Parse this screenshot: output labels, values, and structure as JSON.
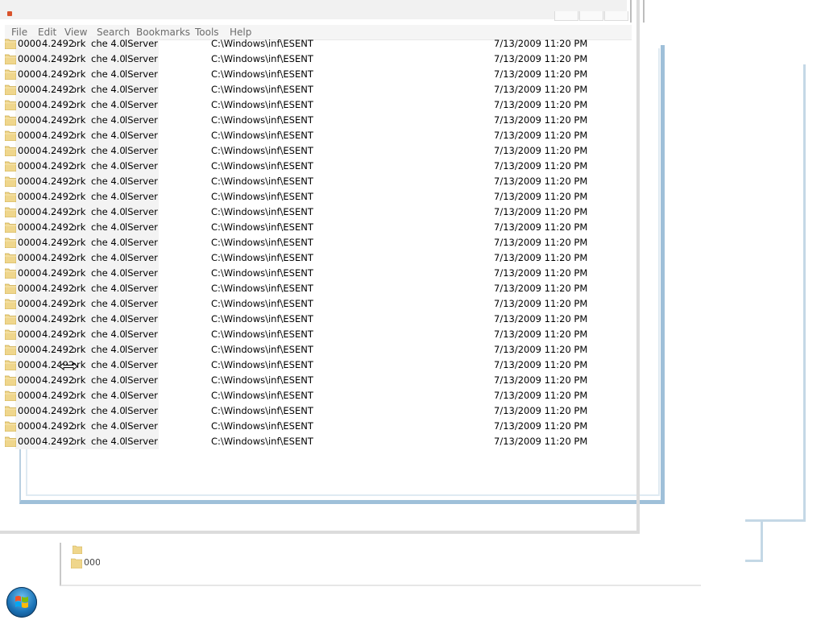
{
  "window": {
    "title": "",
    "menu": [
      "File",
      "Edit",
      "View",
      "Search",
      "Bookmarks",
      "Tools",
      "Help"
    ]
  },
  "list": {
    "rows": [
      [
        "0000",
        "4.2492",
        "ork",
        "che 4.0",
        "lServer",
        "C:\\Windows\\inf\\ESENT",
        "7/13/2009 11:20 PM"
      ],
      [
        "0000",
        "4.2492",
        "ork",
        "che 4.0",
        "lServer",
        "C:\\Windows\\inf\\ESENT",
        "7/13/2009 11:20 PM"
      ],
      [
        "0000",
        "4.2492",
        "ork",
        "che 4.0",
        "lServer",
        "C:\\Windows\\inf\\ESENT",
        "7/13/2009 11:20 PM"
      ],
      [
        "0000",
        "4.2492",
        "ork",
        "che 4.0",
        "lServer",
        "C:\\Windows\\inf\\ESENT",
        "7/13/2009 11:20 PM"
      ],
      [
        "0000",
        "4.2492",
        "ork",
        "che 4.0",
        "lServer",
        "C:\\Windows\\inf\\ESENT",
        "7/13/2009 11:20 PM"
      ],
      [
        "0000",
        "4.2492",
        "ork",
        "che 4.0",
        "lServer",
        "C:\\Windows\\inf\\ESENT",
        "7/13/2009 11:20 PM"
      ],
      [
        "0000",
        "4.2492",
        "ork",
        "che 4.0",
        "lServer",
        "C:\\Windows\\inf\\ESENT",
        "7/13/2009 11:20 PM"
      ],
      [
        "0000",
        "4.2492",
        "ork",
        "che 4.0",
        "lServer",
        "C:\\Windows\\inf\\ESENT",
        "7/13/2009 11:20 PM"
      ],
      [
        "0000",
        "4.2492",
        "ork",
        "che 4.0",
        "lServer",
        "C:\\Windows\\inf\\ESENT",
        "7/13/2009 11:20 PM"
      ],
      [
        "0000",
        "4.2492",
        "ork",
        "che 4.0",
        "lServer",
        "C:\\Windows\\inf\\ESENT",
        "7/13/2009 11:20 PM"
      ],
      [
        "0000",
        "4.2492",
        "ork",
        "che 4.0",
        "lServer",
        "C:\\Windows\\inf\\ESENT",
        "7/13/2009 11:20 PM"
      ],
      [
        "0000",
        "4.2492",
        "ork",
        "che 4.0",
        "lServer",
        "C:\\Windows\\inf\\ESENT",
        "7/13/2009 11:20 PM"
      ],
      [
        "0000",
        "4.2492",
        "ork",
        "che 4.0",
        "lServer",
        "C:\\Windows\\inf\\ESENT",
        "7/13/2009 11:20 PM"
      ],
      [
        "0000",
        "4.2492",
        "ork",
        "che 4.0",
        "lServer",
        "C:\\Windows\\inf\\ESENT",
        "7/13/2009 11:20 PM"
      ],
      [
        "0000",
        "4.2492",
        "ork",
        "che 4.0",
        "lServer",
        "C:\\Windows\\inf\\ESENT",
        "7/13/2009 11:20 PM"
      ],
      [
        "0000",
        "4.2492",
        "ork",
        "che 4.0",
        "lServer",
        "C:\\Windows\\inf\\ESENT",
        "7/13/2009 11:20 PM"
      ],
      [
        "0000",
        "4.2492",
        "ork",
        "che 4.0",
        "lServer",
        "C:\\Windows\\inf\\ESENT",
        "7/13/2009 11:20 PM"
      ],
      [
        "0000",
        "4.2492",
        "ork",
        "che 4.0",
        "lServer",
        "C:\\Windows\\inf\\ESENT",
        "7/13/2009 11:20 PM"
      ],
      [
        "0000",
        "4.2492",
        "ork",
        "che 4.0",
        "lServer",
        "C:\\Windows\\inf\\ESENT",
        "7/13/2009 11:20 PM"
      ],
      [
        "0000",
        "4.2492",
        "ork",
        "che 4.0",
        "lServer",
        "C:\\Windows\\inf\\ESENT",
        "7/13/2009 11:20 PM"
      ],
      [
        "0000",
        "4.2492",
        "ork",
        "che 4.0",
        "lServer",
        "C:\\Windows\\inf\\ESENT",
        "7/13/2009 11:20 PM"
      ],
      [
        "0000",
        "4.2492",
        "ork",
        "che 4.0",
        "lServer",
        "C:\\Windows\\inf\\ESENT",
        "7/13/2009 11:20 PM"
      ],
      [
        "0000",
        "4.2492",
        "ork",
        "che 4.0",
        "lServer",
        "C:\\Windows\\inf\\ESENT",
        "7/13/2009 11:20 PM"
      ],
      [
        "0000",
        "4.2492",
        "ork",
        "che 4.0",
        "lServer",
        "C:\\Windows\\inf\\ESENT",
        "7/13/2009 11:20 PM"
      ],
      [
        "0000",
        "4.2492",
        "ork",
        "che 4.0",
        "lServer",
        "C:\\Windows\\inf\\ESENT",
        "7/13/2009 11:20 PM"
      ],
      [
        "0000",
        "4.2492",
        "ork",
        "che 4.0",
        "lServer",
        "C:\\Windows\\inf\\ESENT",
        "7/13/2009 11:20 PM"
      ],
      [
        "0000",
        "4.2492",
        "ork",
        "che 4.0",
        "lServer",
        "C:\\Windows\\inf\\ESENT",
        "7/13/2009 11:20 PM"
      ]
    ]
  },
  "background_window": {
    "item_text": "0000"
  },
  "icons": {
    "folder": "folder-icon",
    "cursor": "resize-cursor-icon",
    "start": "windows-start-orb-icon"
  },
  "colors": {
    "frame_blue": "#9fc0d9",
    "menu_text": "#6c6c6c",
    "folder": "#e8c86a"
  }
}
